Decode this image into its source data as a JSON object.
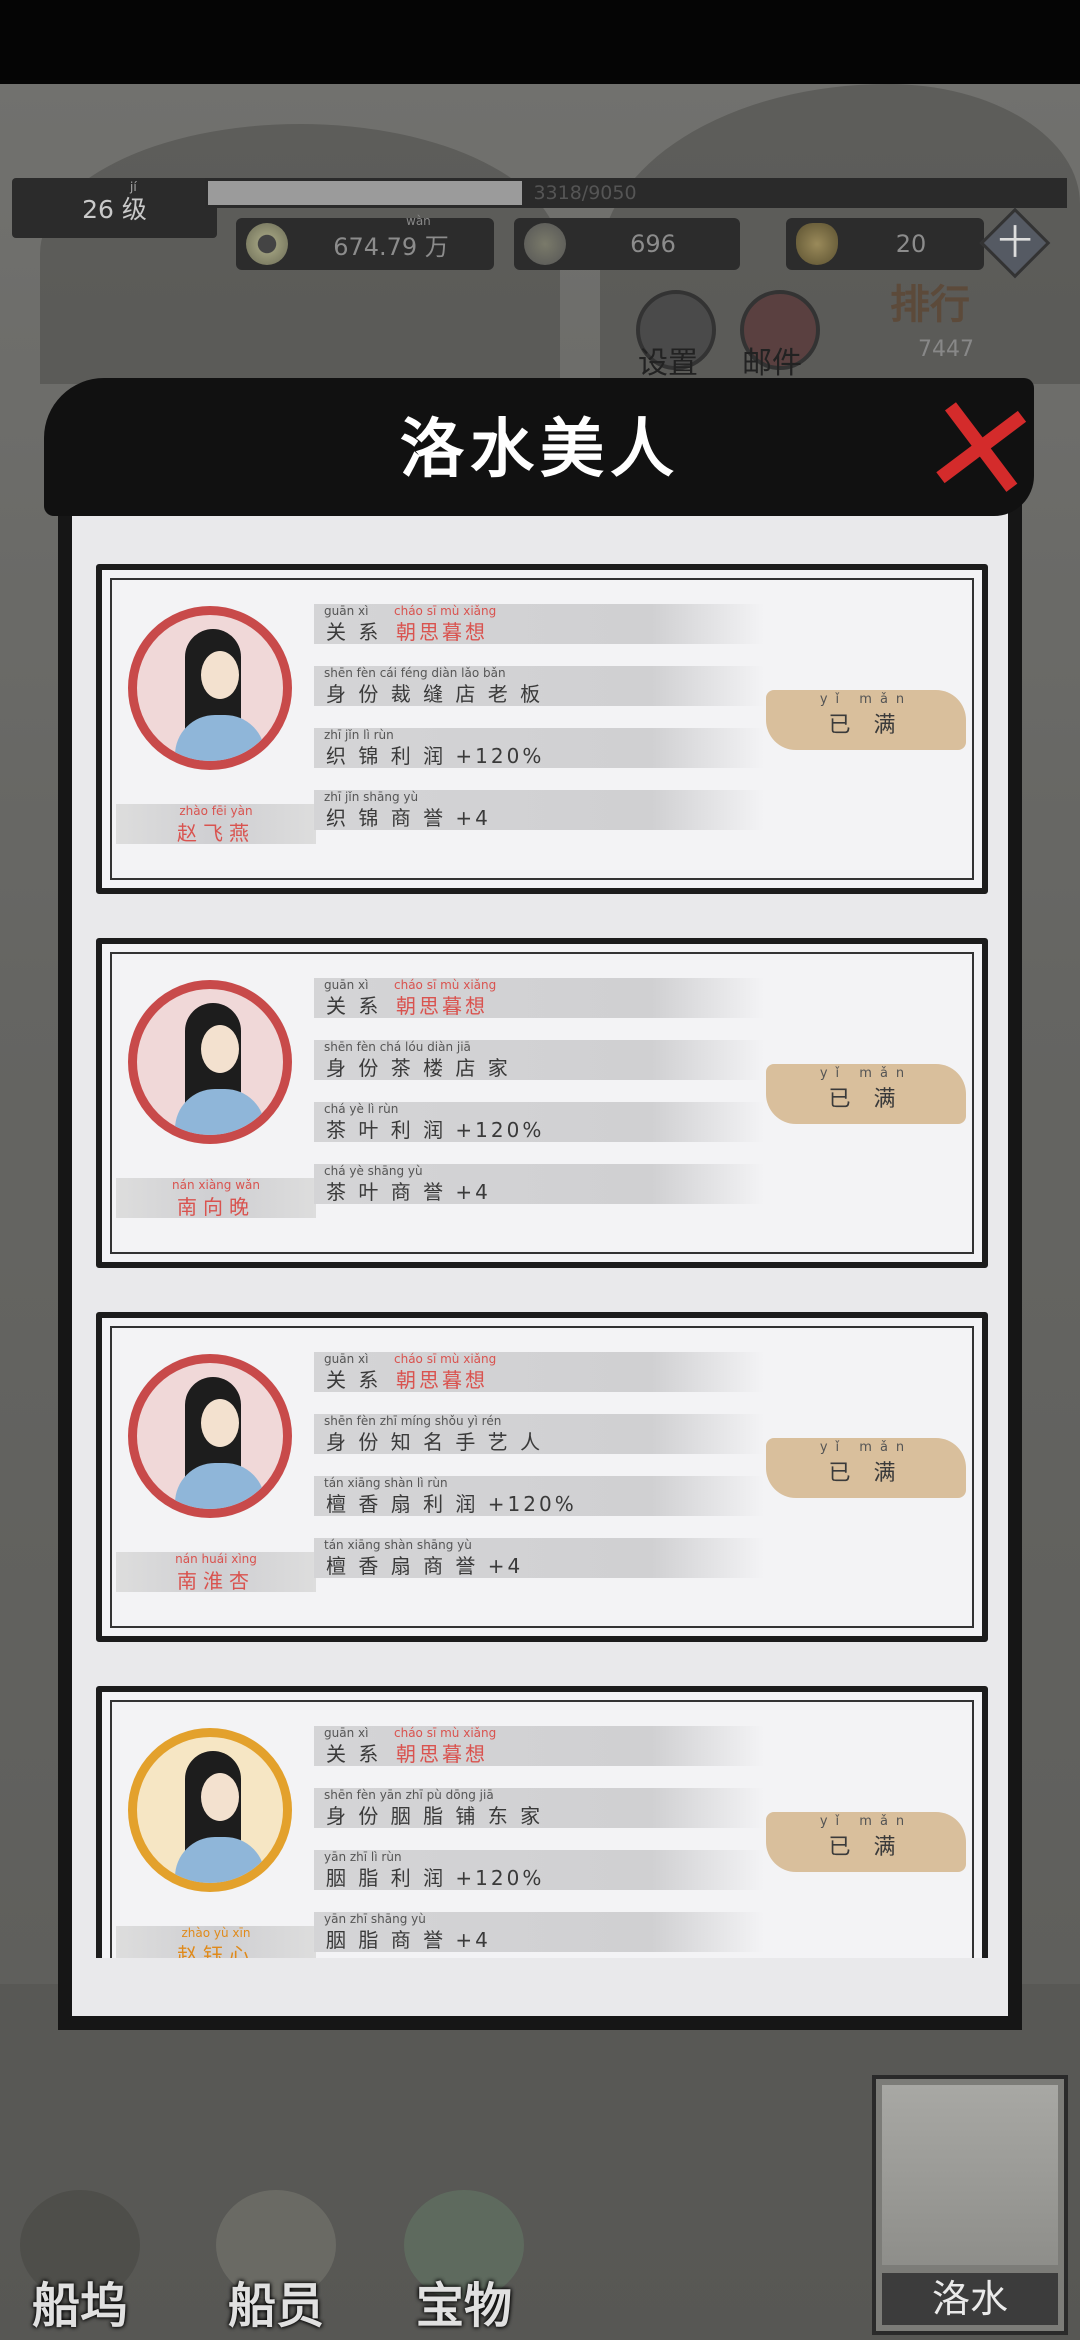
{
  "hud": {
    "level": "26 级",
    "level_pinyin": "jí",
    "exp_text": "3318/9050",
    "exp_fraction": 0.3666,
    "copper_coins": "674.79 万",
    "copper_pinyin": "wàn",
    "shells": "696",
    "gold_ingots": "20",
    "add_label": "十",
    "settings_label": "设置",
    "mail_label": "邮件",
    "rank_label": "排行",
    "rank_value": "7447"
  },
  "modal": {
    "title": "洛水美人",
    "close_label": "✕",
    "cards": [
      {
        "name": "赵飞燕",
        "name_pinyin": "zhào fēi yàn",
        "frame": "red",
        "relation_label": "关 系",
        "relation_pinyin": "guān xì",
        "relation_value": "朝思暮想",
        "relation_value_pinyin": "cháo sī mù xiǎng",
        "identity_pinyin": "shēn fèn  cái féng diàn lǎo bǎn",
        "identity": "身 份  裁 缝 店 老 板",
        "profit_pinyin": "zhī jǐn lì rùn",
        "profit": "织 锦 利 润 +120%",
        "reputation_pinyin": "zhī jǐn shāng yù",
        "reputation": "织 锦 商 誉 +4",
        "status_pinyin": "yǐ mǎn",
        "status": "已 满"
      },
      {
        "name": "南向晚",
        "name_pinyin": "nán xiàng wǎn",
        "frame": "red",
        "relation_label": "关 系",
        "relation_pinyin": "guān xì",
        "relation_value": "朝思暮想",
        "relation_value_pinyin": "cháo sī mù xiǎng",
        "identity_pinyin": "shēn fèn  chá lóu diàn jiā",
        "identity": "身 份  茶 楼 店 家",
        "profit_pinyin": "chá yè lì rùn",
        "profit": "茶 叶 利 润 +120%",
        "reputation_pinyin": "chá yè shāng yù",
        "reputation": "茶 叶 商 誉 +4",
        "status_pinyin": "yǐ mǎn",
        "status": "已 满"
      },
      {
        "name": "南淮杏",
        "name_pinyin": "nán huái xìng",
        "frame": "red",
        "relation_label": "关 系",
        "relation_pinyin": "guān xì",
        "relation_value": "朝思暮想",
        "relation_value_pinyin": "cháo sī mù xiǎng",
        "identity_pinyin": "shēn fèn  zhī míng shǒu yì rén",
        "identity": "身 份  知 名 手 艺 人",
        "profit_pinyin": "tán xiāng shàn lì rùn",
        "profit": "檀 香 扇 利 润 +120%",
        "reputation_pinyin": "tán xiāng shàn shāng yù",
        "reputation": "檀 香 扇 商 誉 +4",
        "status_pinyin": "yǐ mǎn",
        "status": "已 满"
      },
      {
        "name": "赵钰心",
        "name_pinyin": "zhào yù xīn",
        "frame": "gold",
        "relation_label": "关 系",
        "relation_pinyin": "guān xì",
        "relation_value": "朝思暮想",
        "relation_value_pinyin": "cháo sī mù xiǎng",
        "identity_pinyin": "shēn fèn  yān zhī pù dōng jiā",
        "identity": "身 份  胭 脂 铺 东 家",
        "profit_pinyin": "yān zhī lì rùn",
        "profit": "胭 脂 利 润 +120%",
        "reputation_pinyin": "yān zhī shāng yù",
        "reputation": "胭 脂 商 誉 +4",
        "status_pinyin": "yǐ mǎn",
        "status": "已 满"
      }
    ]
  },
  "bottom_nav": {
    "dock": "船坞",
    "crew": "船员",
    "treasure": "宝物",
    "map": "洛水"
  },
  "colors": {
    "accent_red": "#d9534f",
    "gold": "#e08a1a",
    "button_tan": "#d9bf9c"
  }
}
